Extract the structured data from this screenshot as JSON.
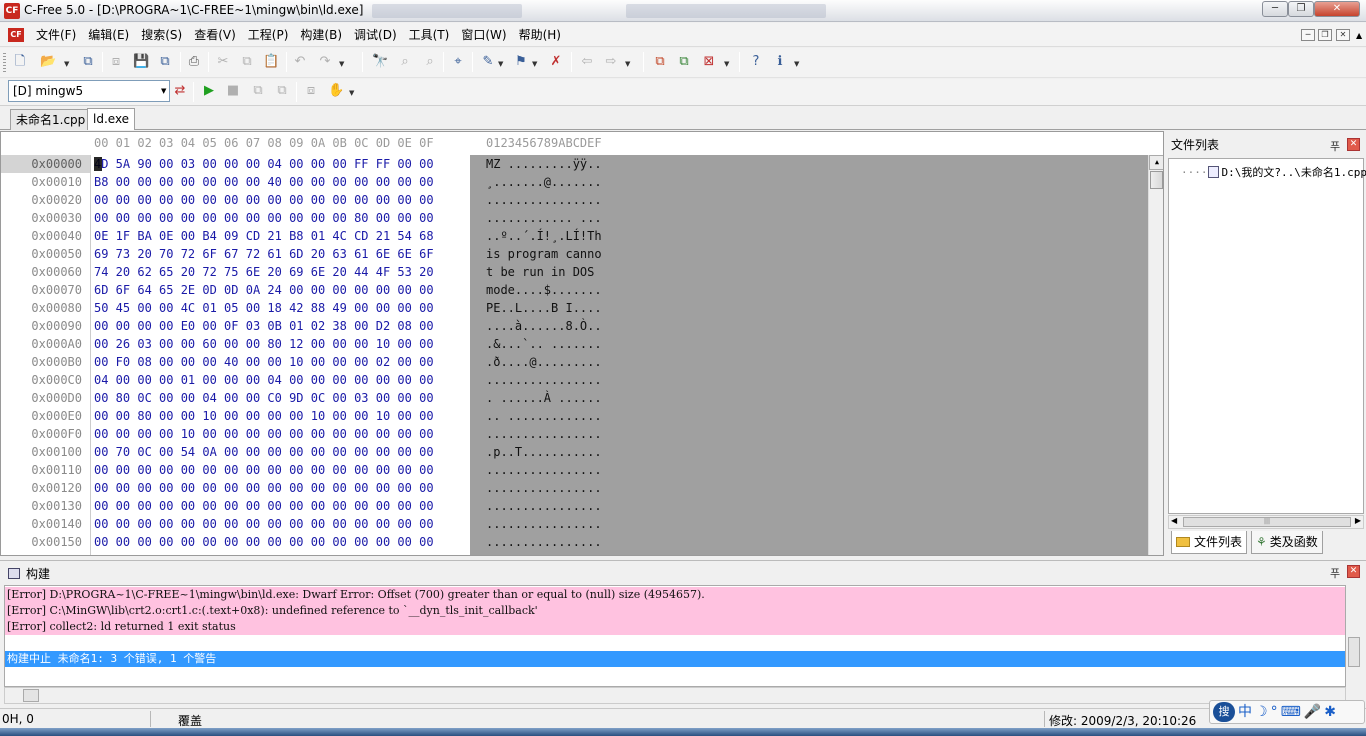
{
  "window": {
    "title": "C-Free 5.0 - [D:\\PROGRA~1\\C-FREE~1\\mingw\\bin\\ld.exe]",
    "app_icon": "C-Free logo"
  },
  "menu": {
    "items": [
      "文件(F)",
      "编辑(E)",
      "搜索(S)",
      "查看(V)",
      "工程(P)",
      "构建(B)",
      "调试(D)",
      "工具(T)",
      "窗口(W)",
      "帮助(H)"
    ]
  },
  "toolbar2": {
    "config_value": "[D] mingw5"
  },
  "tabs": [
    {
      "label": "未命名1.cpp",
      "active": false
    },
    {
      "label": "ld.exe",
      "active": true
    }
  ],
  "hex_editor": {
    "column_header": "00 01 02 03 04 05 06 07 08 09 0A 0B 0C 0D 0E 0F",
    "ascii_header": "0123456789ABCDEF",
    "rows": [
      {
        "addr": "0x00000",
        "hex": "4D 5A 90 00 03 00 00 00 04 00 00 00 FF FF 00 00",
        "ascii": "MZ .........ÿÿ.."
      },
      {
        "addr": "0x00010",
        "hex": "B8 00 00 00 00 00 00 00 40 00 00 00 00 00 00 00",
        "ascii": "¸.......@......."
      },
      {
        "addr": "0x00020",
        "hex": "00 00 00 00 00 00 00 00 00 00 00 00 00 00 00 00",
        "ascii": "................"
      },
      {
        "addr": "0x00030",
        "hex": "00 00 00 00 00 00 00 00 00 00 00 00 80 00 00 00",
        "ascii": "............ ..."
      },
      {
        "addr": "0x00040",
        "hex": "0E 1F BA 0E 00 B4 09 CD 21 B8 01 4C CD 21 54 68",
        "ascii": "..º..´.Í!¸.LÍ!Th"
      },
      {
        "addr": "0x00050",
        "hex": "69 73 20 70 72 6F 67 72 61 6D 20 63 61 6E 6E 6F",
        "ascii": "is program canno"
      },
      {
        "addr": "0x00060",
        "hex": "74 20 62 65 20 72 75 6E 20 69 6E 20 44 4F 53 20",
        "ascii": "t be run in DOS "
      },
      {
        "addr": "0x00070",
        "hex": "6D 6F 64 65 2E 0D 0D 0A 24 00 00 00 00 00 00 00",
        "ascii": "mode....$......."
      },
      {
        "addr": "0x00080",
        "hex": "50 45 00 00 4C 01 05 00 18 42 88 49 00 00 00 00",
        "ascii": "PE..L....B I...."
      },
      {
        "addr": "0x00090",
        "hex": "00 00 00 00 E0 00 0F 03 0B 01 02 38 00 D2 08 00",
        "ascii": "....à......8.Ò.."
      },
      {
        "addr": "0x000A0",
        "hex": "00 26 03 00 00 60 00 00 80 12 00 00 00 10 00 00",
        "ascii": ".&...`.. ......."
      },
      {
        "addr": "0x000B0",
        "hex": "00 F0 08 00 00 00 40 00 00 10 00 00 00 02 00 00",
        "ascii": ".ð....@........."
      },
      {
        "addr": "0x000C0",
        "hex": "04 00 00 00 01 00 00 00 04 00 00 00 00 00 00 00",
        "ascii": "................"
      },
      {
        "addr": "0x000D0",
        "hex": "00 80 0C 00 00 04 00 00 C0 9D 0C 00 03 00 00 00",
        "ascii": ". ......À ......"
      },
      {
        "addr": "0x000E0",
        "hex": "00 00 80 00 00 10 00 00 00 00 10 00 00 10 00 00",
        "ascii": ".. ............."
      },
      {
        "addr": "0x000F0",
        "hex": "00 00 00 00 10 00 00 00 00 00 00 00 00 00 00 00",
        "ascii": "................"
      },
      {
        "addr": "0x00100",
        "hex": "00 70 0C 00 54 0A 00 00 00 00 00 00 00 00 00 00",
        "ascii": ".p..T..........."
      },
      {
        "addr": "0x00110",
        "hex": "00 00 00 00 00 00 00 00 00 00 00 00 00 00 00 00",
        "ascii": "................"
      },
      {
        "addr": "0x00120",
        "hex": "00 00 00 00 00 00 00 00 00 00 00 00 00 00 00 00",
        "ascii": "................"
      },
      {
        "addr": "0x00130",
        "hex": "00 00 00 00 00 00 00 00 00 00 00 00 00 00 00 00",
        "ascii": "................"
      },
      {
        "addr": "0x00140",
        "hex": "00 00 00 00 00 00 00 00 00 00 00 00 00 00 00 00",
        "ascii": "................"
      },
      {
        "addr": "0x00150",
        "hex": "00 00 00 00 00 00 00 00 00 00 00 00 00 00 00 00",
        "ascii": "................"
      }
    ]
  },
  "file_panel": {
    "title": "文件列表",
    "tree_item": "D:\\我的文?..\\未命名1.cpp",
    "tabs": [
      "文件列表",
      "类及函数"
    ]
  },
  "build_panel": {
    "title": "构建",
    "errors": [
      "[Error] D:\\PROGRA~1\\C-FREE~1\\mingw\\bin\\ld.exe: Dwarf Error: Offset (700) greater than or equal to (null) size (4954657).",
      "[Error] C:\\MinGW\\lib\\crt2.o:crt1.c:(.text+0x8): undefined reference to `__dyn_tls_init_callback'",
      "[Error] collect2: ld returned 1 exit status"
    ],
    "summary": "构建中止 未命名1: 3 个错误, 1 个警告"
  },
  "statusbar": {
    "position": "0H, 0",
    "mode": "覆盖",
    "modified": "修改: 2009/2/3, 20:10:26"
  },
  "ime": {
    "logo": "搜",
    "mode": "中"
  },
  "colors": {
    "hex_text": "#1a1aa8",
    "ascii_bg": "#a0a0a0",
    "error_bg": "#ffc2e0",
    "summary_bg": "#3399ff"
  }
}
